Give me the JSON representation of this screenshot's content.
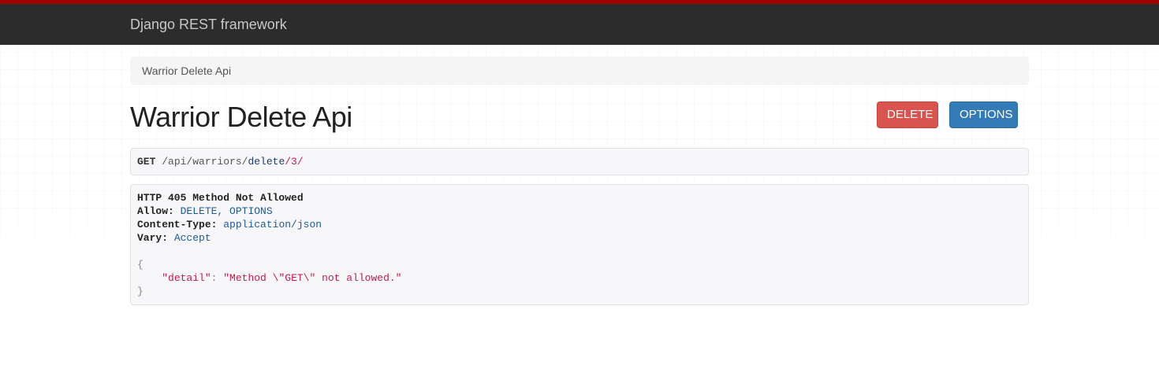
{
  "navbar": {
    "brand": "Django REST framework"
  },
  "breadcrumb": {
    "item": "Warrior Delete Api"
  },
  "page": {
    "title": "Warrior Delete Api"
  },
  "buttons": {
    "delete": "DELETE",
    "options": "OPTIONS"
  },
  "request": {
    "method": "GET",
    "path_prefix": "/api/warriors/",
    "path_highlight": "delete",
    "path_suffix": "/3/"
  },
  "response": {
    "status": "HTTP 405 Method Not Allowed",
    "headers": [
      {
        "name": "Allow:",
        "value": "DELETE, OPTIONS"
      },
      {
        "name": "Content-Type:",
        "value": "application/json"
      },
      {
        "name": "Vary:",
        "value": "Accept"
      }
    ],
    "body_open": "{",
    "body_key": "\"detail\"",
    "body_value": "\"Method \\\"GET\\\" not allowed.\"",
    "body_close": "}"
  },
  "colors": {
    "navbar_bg": "#2c2c2c",
    "navbar_accent": "#a30000",
    "delete_button": "#d9534f",
    "options_button": "#337ab7"
  }
}
